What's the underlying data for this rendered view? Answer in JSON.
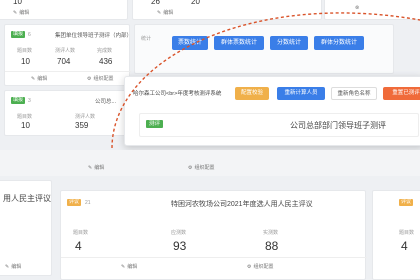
{
  "top_row": {
    "values": [
      "10",
      "",
      "26",
      "20"
    ],
    "actions": [
      "编辑",
      "",
      "",
      "编辑"
    ]
  },
  "left_cards": [
    {
      "tag": "填报",
      "count": "6",
      "title": "集团单位领导班子测评（内部）",
      "stats": [
        {
          "label": "题目数",
          "value": "10"
        },
        {
          "label": "测评人数",
          "value": "704"
        },
        {
          "label": "完成数",
          "value": "436"
        }
      ],
      "actions": [
        "编辑",
        "组织配置"
      ]
    },
    {
      "tag": "填报",
      "count": "3",
      "title": "公司总...",
      "stats": [
        {
          "label": "题目数",
          "value": "10"
        },
        {
          "label": "测评人数",
          "value": "359"
        }
      ]
    }
  ],
  "toolbar": {
    "buttons": [
      "票数统计",
      "群体票数统计",
      "分数统计",
      "群体分数统计"
    ],
    "first_prefix": "统计"
  },
  "popup": {
    "title": "哈尔森工公司<br>年度考核测评系统",
    "buttons": [
      "配置校验",
      "重新计算人员",
      "重新角色名称",
      "重置已测评"
    ],
    "tag": "测评",
    "subtitle": "公司总部部门领导班子测评"
  },
  "bottom_cards": [
    {
      "title": "用人民主评议",
      "actions": [
        "编辑"
      ]
    },
    {
      "tag": "评议",
      "count": "21",
      "title": "特困河农牧场公司2021年度选人用人民主评议",
      "stats": [
        {
          "label": "题目数",
          "value": "4"
        },
        {
          "label": "应测数",
          "value": "93"
        },
        {
          "label": "实测数",
          "value": "88"
        }
      ],
      "actions": [
        "编辑",
        "组织配置"
      ]
    },
    {
      "tag": "评议",
      "stats": [
        {
          "label": "题目数",
          "value": "4"
        }
      ]
    }
  ],
  "colors": {
    "primary": "#3a7ee8",
    "warning": "#f0b04a",
    "danger": "#f06b3a",
    "tag_green": "#4caf50",
    "annotation_dash": "#d9532a"
  }
}
